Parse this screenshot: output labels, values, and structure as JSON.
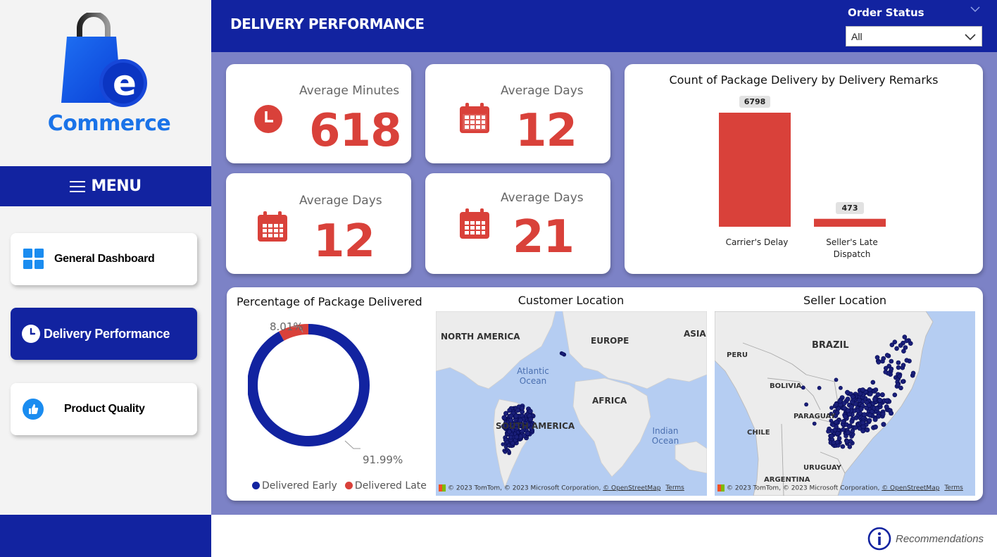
{
  "brand": {
    "logo_text": "Commerce",
    "logo_letter": "e"
  },
  "menu": {
    "label": "MENU"
  },
  "nav": {
    "general": "General Dashboard",
    "delivery": "Delivery Performance",
    "product": "Product Quality"
  },
  "header": {
    "title": "DELIVERY PERFORMANCE"
  },
  "slicer": {
    "label": "Order Status",
    "value": "All"
  },
  "kpis": [
    {
      "title": "Average Minutes",
      "value": "618",
      "icon": "clock-icon"
    },
    {
      "title": "Average Days",
      "value": "12",
      "icon": "calendar-icon"
    },
    {
      "title": "Average Days",
      "value": "12",
      "icon": "calendar-icon"
    },
    {
      "title": "Average Days",
      "value": "21",
      "icon": "calendar-icon"
    }
  ],
  "bar_chart": {
    "title": "Count of Package Delivery by Delivery Remarks",
    "cat1": "Carrier's Delay",
    "cat2_line1": "Seller's Late",
    "cat2_line2": "Dispatch",
    "label1": "6798",
    "label2": "473"
  },
  "donut_chart": {
    "title": "Percentage of Package Delivered",
    "late_pct": "8.01%",
    "early_pct": "91.99%",
    "legend_early": "Delivered Early",
    "legend_late": "Delivered Late"
  },
  "chart_data": [
    {
      "type": "bar",
      "title": "Count of Package Delivery by Delivery Remarks",
      "categories": [
        "Carrier's Delay",
        "Seller's Late Dispatch"
      ],
      "values": [
        6798,
        473
      ],
      "color": "#d9413a"
    },
    {
      "type": "pie",
      "title": "Percentage of Package Delivered",
      "categories": [
        "Delivered Early",
        "Delivered Late"
      ],
      "values": [
        91.99,
        8.01
      ],
      "colors": [
        "#1223a0",
        "#d9413a"
      ],
      "legend": "bottom"
    }
  ],
  "customer_map": {
    "title": "Customer Location",
    "labels": {
      "na": "NORTH AMERICA",
      "eu": "EUROPE",
      "asia": "ASIA",
      "africa": "AFRICA",
      "sa": "SOUTH AMERICA"
    },
    "oceans": {
      "atlantic1": "Atlantic",
      "atlantic2": "Ocean",
      "indian1": "Indian",
      "indian2": "Ocean"
    },
    "attribution": "© 2023 TomTom, © 2023 Microsoft Corporation,",
    "osm": "© OpenStreetMap",
    "terms": "Terms"
  },
  "seller_map": {
    "title": "Seller Location",
    "labels": {
      "brazil": "BRAZIL",
      "peru": "PERU",
      "bolivia": "BOLIVIA",
      "paraguay": "PARAGUAY",
      "chile": "CHILE",
      "uruguay": "URUGUAY",
      "argentina": "ARGENTINA"
    },
    "attribution": "© 2023 TomTom, © 2023 Microsoft Corporation,",
    "osm": "© OpenStreetMap",
    "terms": "Terms"
  },
  "footer": {
    "recommendations": "Recommendations"
  },
  "colors": {
    "navy": "#1223a0",
    "red": "#d9413a",
    "canvas": "#7c82c6",
    "dot": "#1a1f7a"
  }
}
